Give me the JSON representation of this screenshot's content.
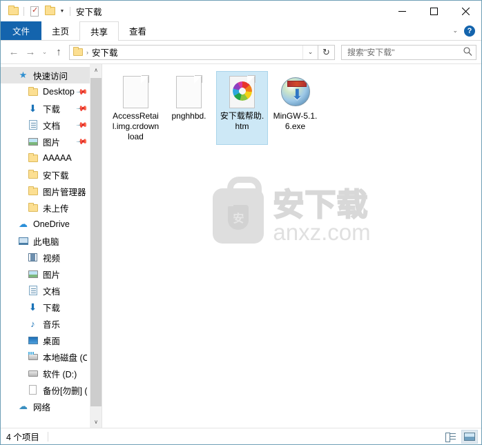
{
  "window": {
    "title": "安下载",
    "quick_access_toolbar": [
      {
        "name": "folder-icon",
        "label": "文件夹"
      },
      {
        "name": "properties-icon",
        "label": "属性"
      },
      {
        "name": "new-folder-icon",
        "label": "新建文件夹"
      }
    ],
    "qat_dropdown_label": "自定义快速访问工具栏",
    "controls": {
      "minimize": "—",
      "maximize": "□",
      "close": "✕"
    }
  },
  "ribbon": {
    "tabs": [
      {
        "label": "文件",
        "state": "file"
      },
      {
        "label": "主页",
        "state": "normal"
      },
      {
        "label": "共享",
        "state": "active"
      },
      {
        "label": "查看",
        "state": "normal"
      }
    ],
    "collapse_label": "⌄",
    "help_label": "?"
  },
  "addressbar": {
    "back_label": "←",
    "forward_label": "→",
    "recent_label": "⌄",
    "up_label": "↑",
    "path_text": "安下载",
    "path_separator": "›",
    "dropdown_label": "⌄",
    "refresh_label": "↻"
  },
  "search": {
    "placeholder": "搜索\"安下载\"",
    "icon": "search-icon"
  },
  "sidebar": {
    "items": [
      {
        "label": "快速访问",
        "icon": "star-icon",
        "level": 0,
        "selected": true,
        "pinned": false
      },
      {
        "label": "Desktop",
        "icon": "folder-icon",
        "level": 1,
        "selected": false,
        "pinned": true
      },
      {
        "label": "下载",
        "icon": "download-icon",
        "level": 1,
        "selected": false,
        "pinned": true
      },
      {
        "label": "文档",
        "icon": "documents-icon",
        "level": 1,
        "selected": false,
        "pinned": true
      },
      {
        "label": "图片",
        "icon": "pictures-icon",
        "level": 1,
        "selected": false,
        "pinned": true
      },
      {
        "label": "AAAAA",
        "icon": "folder-icon",
        "level": 1,
        "selected": false,
        "pinned": false
      },
      {
        "label": "安下载",
        "icon": "folder-icon",
        "level": 1,
        "selected": false,
        "pinned": false
      },
      {
        "label": "图片管理器",
        "icon": "folder-icon",
        "level": 1,
        "selected": false,
        "pinned": false
      },
      {
        "label": "未上传",
        "icon": "folder-icon",
        "level": 1,
        "selected": false,
        "pinned": false
      },
      {
        "label": "OneDrive",
        "icon": "cloud-icon",
        "level": 0,
        "selected": false,
        "pinned": false
      },
      {
        "label": "此电脑",
        "icon": "computer-icon",
        "level": 0,
        "selected": false,
        "pinned": false
      },
      {
        "label": "视频",
        "icon": "video-icon",
        "level": 1,
        "selected": false,
        "pinned": false
      },
      {
        "label": "图片",
        "icon": "pictures-icon",
        "level": 1,
        "selected": false,
        "pinned": false
      },
      {
        "label": "文档",
        "icon": "documents-icon",
        "level": 1,
        "selected": false,
        "pinned": false
      },
      {
        "label": "下载",
        "icon": "download-icon",
        "level": 1,
        "selected": false,
        "pinned": false
      },
      {
        "label": "音乐",
        "icon": "music-icon",
        "level": 1,
        "selected": false,
        "pinned": false
      },
      {
        "label": "桌面",
        "icon": "desktop-icon",
        "level": 1,
        "selected": false,
        "pinned": false
      },
      {
        "label": "本地磁盘 (C:)",
        "icon": "system-drive-icon",
        "level": 1,
        "selected": false,
        "pinned": false
      },
      {
        "label": "软件 (D:)",
        "icon": "drive-icon",
        "level": 1,
        "selected": false,
        "pinned": false
      },
      {
        "label": "备份[勿删] (E:)",
        "icon": "file-page-icon",
        "level": 1,
        "selected": false,
        "pinned": false
      },
      {
        "label": "网络",
        "icon": "network-icon",
        "level": 0,
        "selected": false,
        "pinned": false
      }
    ],
    "scrollbar": {
      "up_label": "∧",
      "down_label": "∨"
    }
  },
  "files": [
    {
      "name": "AccessRetail.img.crdownload",
      "icon": "generic-file-icon",
      "selected": false
    },
    {
      "name": "pnghhbd.",
      "icon": "generic-file-icon",
      "selected": false
    },
    {
      "name": "安下载帮助.htm",
      "icon": "html-file-icon",
      "selected": true
    },
    {
      "name": "MinGW-5.1.6.exe",
      "icon": "executable-icon",
      "selected": false
    }
  ],
  "watermark": {
    "shield_char": "安",
    "chinese_text": "安下载",
    "domain_text": "anxz.com"
  },
  "statusbar": {
    "item_count_text": "4 个项目",
    "view_buttons": [
      {
        "name": "details-view-button",
        "active": false
      },
      {
        "name": "large-icons-view-button",
        "active": true
      }
    ]
  },
  "colors": {
    "accent": "#1464ad",
    "selection": "#cde8f6",
    "folder": "#fcdf92",
    "window_border": "#6d9eb5"
  }
}
